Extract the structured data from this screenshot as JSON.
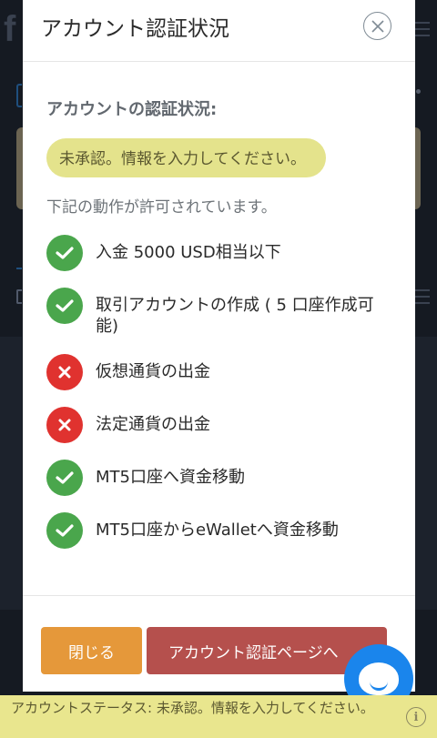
{
  "background": {
    "logo_text": "f"
  },
  "modal": {
    "title": "アカウント認証状況",
    "close_icon": "close-icon",
    "status_heading": "アカウントの認証状況:",
    "status_value": "未承認。情報を入力してください。",
    "allowed_intro": "下記の動作が許可されています。",
    "permissions": [
      {
        "label": "入金 5000 USD相当以下",
        "allowed": true
      },
      {
        "label": "取引アカウントの作成 ( 5 口座作成可能)",
        "allowed": true
      },
      {
        "label": "仮想通貨の出金",
        "allowed": false
      },
      {
        "label": "法定通貨の出金",
        "allowed": false
      },
      {
        "label": "MT5口座へ資金移動",
        "allowed": true
      },
      {
        "label": "MT5口座からeWalletへ資金移動",
        "allowed": true
      }
    ],
    "footer": {
      "close_label": "閉じる",
      "verify_label": "アカウント認証ページへ"
    }
  },
  "status_bar": {
    "text": "アカウントステータス: 未承認。情報を入力してください。",
    "info_icon": "info-icon"
  },
  "chat": {
    "icon": "chat-icon"
  },
  "colors": {
    "allowed": "#4aa64c",
    "denied": "#e0322f",
    "status_highlight": "#e4e38c",
    "close_button": "#e5983a",
    "verify_button": "#b5504d",
    "chat": "#1a85ec"
  }
}
